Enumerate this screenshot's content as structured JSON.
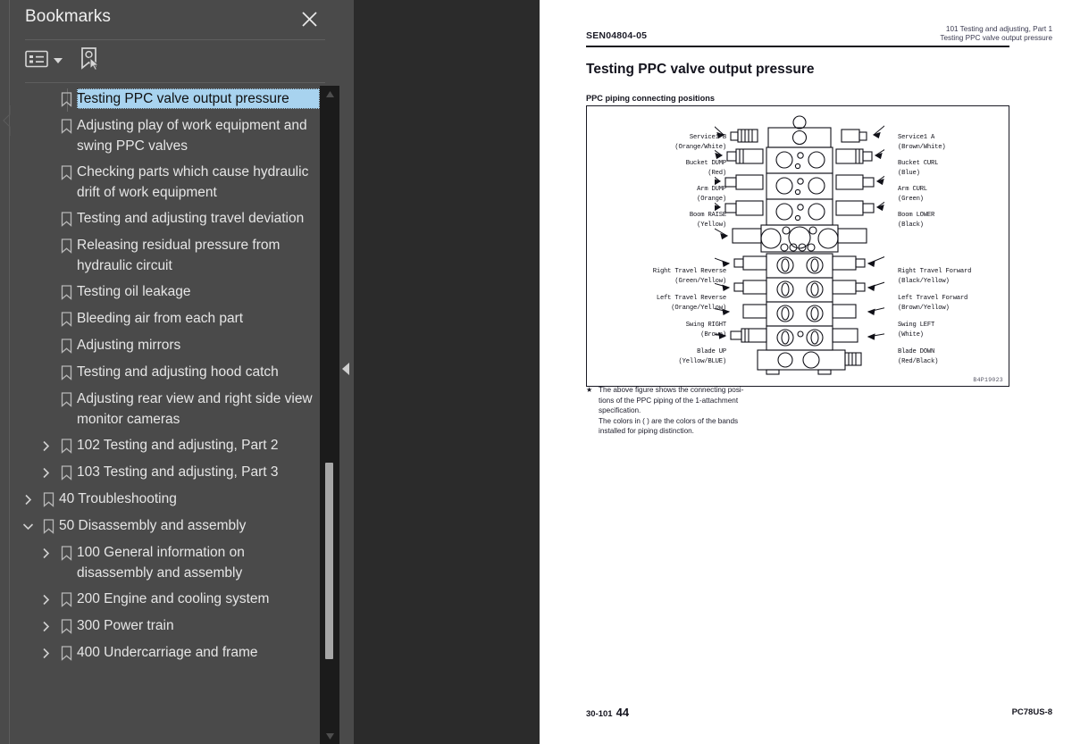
{
  "panel": {
    "title": "Bookmarks",
    "close_icon": "close-icon",
    "toolbar": {
      "list_options_label": "list-options",
      "list_options_icon": "bookmark-list-icon",
      "dropdown_icon": "chevron-down-icon",
      "add_bookmark_label": "new-bookmark",
      "add_bookmark_icon": "add-bookmark-icon"
    },
    "scrollbar": {
      "up_icon": "scroll-up-arrow-icon",
      "down_icon": "scroll-down-arrow-icon"
    },
    "collapse_icon": "collapse-panel-arrow-icon",
    "items": [
      {
        "label": "Testing PPC valve output pressure",
        "level": 3,
        "twisty": "",
        "selected": true
      },
      {
        "label": "Adjusting play of work equipment and swing PPC valves",
        "level": 3,
        "twisty": "",
        "selected": false
      },
      {
        "label": "Checking parts which cause hydraulic drift of work equipment",
        "level": 3,
        "twisty": "",
        "selected": false
      },
      {
        "label": "Testing and adjusting travel deviation",
        "level": 3,
        "twisty": "",
        "selected": false
      },
      {
        "label": "Releasing residual pressure from hydraulic circuit",
        "level": 3,
        "twisty": "",
        "selected": false
      },
      {
        "label": "Testing oil leakage",
        "level": 3,
        "twisty": "",
        "selected": false
      },
      {
        "label": "Bleeding air from each part",
        "level": 3,
        "twisty": "",
        "selected": false
      },
      {
        "label": "Adjusting mirrors",
        "level": 3,
        "twisty": "",
        "selected": false
      },
      {
        "label": "Testing and adjusting hood catch",
        "level": 3,
        "twisty": "",
        "selected": false
      },
      {
        "label": "Adjusting rear view and right side view monitor cameras",
        "level": 3,
        "twisty": "",
        "selected": false
      },
      {
        "label": "102 Testing and adjusting, Part 2",
        "level": 2,
        "twisty": "collapsed",
        "selected": false
      },
      {
        "label": "103 Testing and adjusting, Part 3",
        "level": 2,
        "twisty": "collapsed",
        "selected": false
      },
      {
        "label": "40 Troubleshooting",
        "level": 1,
        "twisty": "collapsed",
        "selected": false
      },
      {
        "label": "50 Disassembly and assembly",
        "level": 1,
        "twisty": "expanded",
        "selected": false
      },
      {
        "label": "100 General information on disassembly and assembly",
        "level": 2,
        "twisty": "collapsed",
        "selected": false
      },
      {
        "label": "200 Engine and cooling system",
        "level": 2,
        "twisty": "collapsed",
        "selected": false
      },
      {
        "label": "300 Power train",
        "level": 2,
        "twisty": "collapsed",
        "selected": false
      },
      {
        "label": "400 Undercarriage and frame",
        "level": 2,
        "twisty": "collapsed",
        "selected": false
      }
    ]
  },
  "page": {
    "header_left": "SEN04804-05",
    "header_right_line1": "101 Testing and adjusting, Part 1",
    "header_right_line2": "Testing PPC valve output pressure",
    "title": "Testing PPC valve output pressure",
    "subtitle": "PPC piping connecting positions",
    "figure_code": "B4P19023",
    "note_star": "★",
    "note_line1": "The above figure shows the connecting posi-",
    "note_line2": "tions of the PPC piping of the 1-attachment",
    "note_line3": "specification.",
    "note_line4": "The colors in ( ) are the colors of the bands",
    "note_line5": "installed for piping distinction.",
    "footer_section": "30-101",
    "footer_page": "44",
    "footer_model": "PC78US-8",
    "figure_labels": {
      "left_upper": [
        {
          "name": "Service1 B",
          "color": "(Orange/White)"
        },
        {
          "name": "Bucket DUMP",
          "color": "(Red)"
        },
        {
          "name": "Arm DUMP",
          "color": "(Orange)"
        },
        {
          "name": "Boom RAISE",
          "color": "(Yellow)"
        }
      ],
      "right_upper": [
        {
          "name": "Service1 A",
          "color": "(Brown/White)"
        },
        {
          "name": "Bucket CURL",
          "color": "(Blue)"
        },
        {
          "name": "Arm CURL",
          "color": "(Green)"
        },
        {
          "name": "Boom LOWER",
          "color": "(Black)"
        }
      ],
      "left_lower": [
        {
          "name": "Right Travel Reverse",
          "color": "(Green/Yellow)"
        },
        {
          "name": "Left Travel Reverse",
          "color": "(Orange/Yellow)"
        },
        {
          "name": "Swing RIGHT",
          "color": "(Brown)"
        },
        {
          "name": "Blade UP",
          "color": "(Yellow/BLUE)"
        }
      ],
      "right_lower": [
        {
          "name": "Right Travel Forward",
          "color": "(Black/Yellow)"
        },
        {
          "name": "Left Travel Forward",
          "color": "(Brown/Yellow)"
        },
        {
          "name": "Swing LEFT",
          "color": "(White)"
        },
        {
          "name": "Blade DOWN",
          "color": "(Red/Black)"
        }
      ]
    }
  },
  "colors": {
    "panel_bg": "#4a4a4a",
    "viewer_bg": "#2b2b2b",
    "selection": "#a8d3ef",
    "page_bg": "#ffffff",
    "scroll_track": "#1b1b1b",
    "scroll_thumb": "#a6a6a6"
  }
}
